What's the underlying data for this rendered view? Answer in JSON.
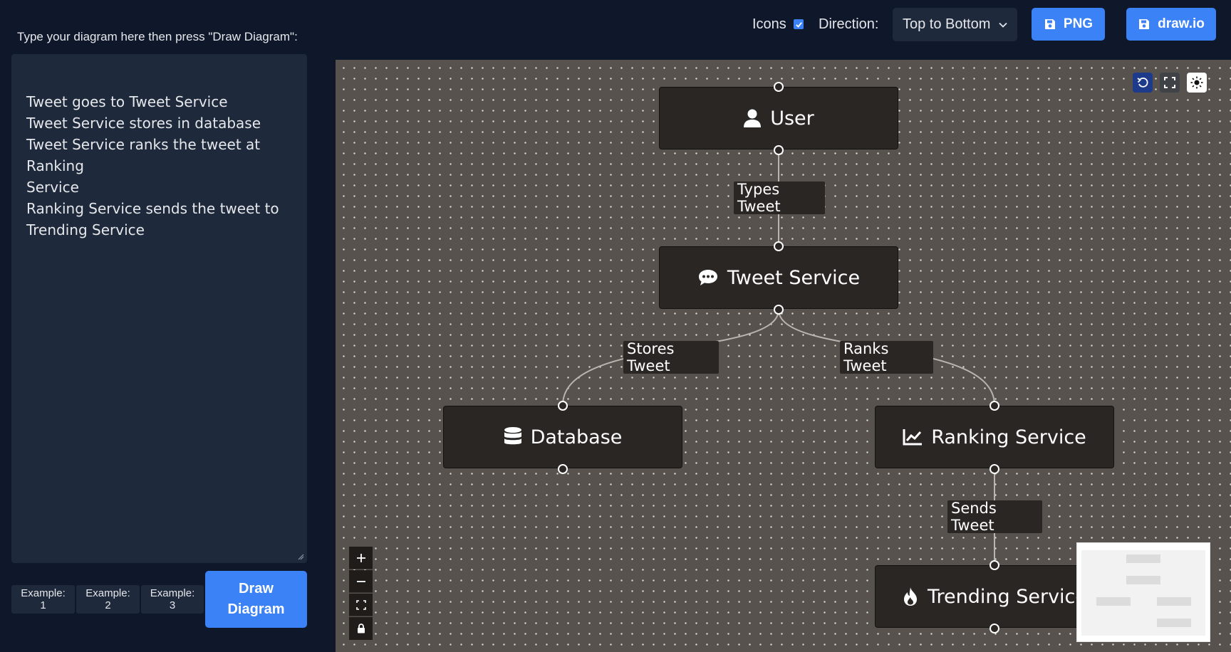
{
  "prompt_label": "Type your diagram here then press \"Draw Diagram\":",
  "editor": {
    "lines": [
      "Tweet goes to Tweet Service",
      "Tweet Service stores in database",
      "Tweet Service ranks the tweet at Ranking",
      "Service",
      "Ranking Service sends the tweet to",
      "Trending Service"
    ]
  },
  "examples": [
    "Example: 1",
    "Example: 2",
    "Example: 3"
  ],
  "draw_button": {
    "line1": "Draw",
    "line2": "Diagram"
  },
  "toolbar": {
    "icons_label": "Icons",
    "icons_checked": true,
    "direction_label": "Direction:",
    "direction_value": "Top to Bottom",
    "png_label": "PNG",
    "drawio_label": "draw.io"
  },
  "diagram": {
    "nodes": {
      "user": {
        "label": "User",
        "icon": "user-icon"
      },
      "tweet_service": {
        "label": "Tweet Service",
        "icon": "chat-bubble-icon"
      },
      "database": {
        "label": "Database",
        "icon": "database-icon"
      },
      "ranking_service": {
        "label": "Ranking Service",
        "icon": "chart-line-icon"
      },
      "trending_service": {
        "label": "Trending Service",
        "icon": "fire-icon"
      }
    },
    "edges": {
      "types_tweet": "Types Tweet",
      "stores_tweet": "Stores Tweet",
      "ranks_tweet": "Ranks Tweet",
      "sends_tweet": "Sends Tweet"
    }
  },
  "colors": {
    "accent": "#3b82f6",
    "page_bg": "#0f172a",
    "panel_bg": "#1e293b",
    "canvas_bg": "#57524d",
    "node_bg": "#2a2624"
  }
}
